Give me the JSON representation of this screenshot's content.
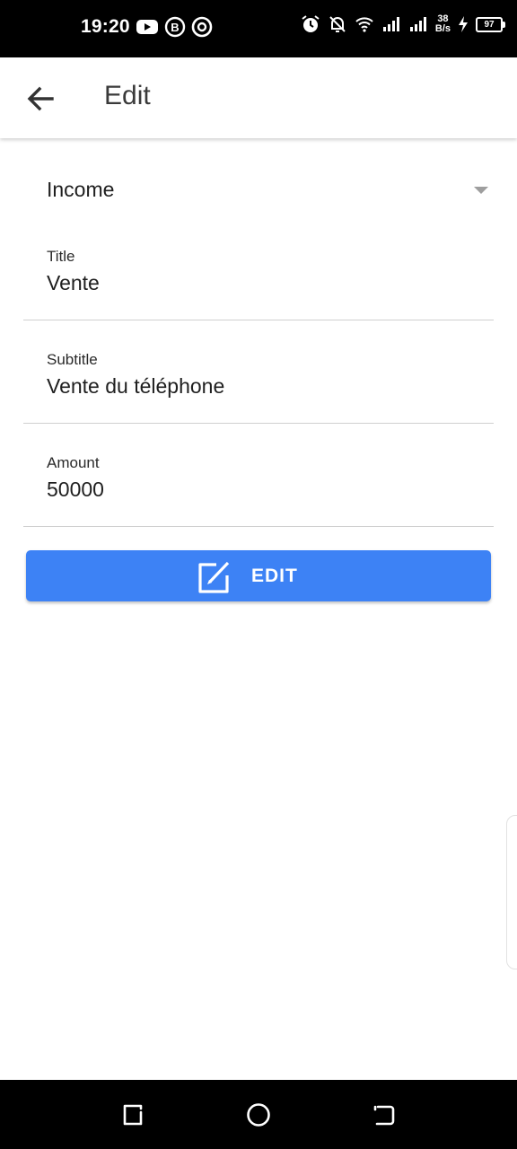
{
  "status_bar": {
    "time": "19:20",
    "net_speed_value": "38",
    "net_speed_unit": "B/s",
    "battery": "97",
    "icons": [
      "youtube-icon",
      "b-circle-icon",
      "at-circle-icon",
      "alarm-icon",
      "notifications-off-icon",
      "wifi-icon",
      "signal-icon",
      "signal-icon",
      "charging-icon"
    ]
  },
  "app_bar": {
    "title": "Edit",
    "back_icon": "arrow-back-icon"
  },
  "form": {
    "type_value": "Income",
    "fields": [
      {
        "label": "Title",
        "value": "Vente"
      },
      {
        "label": "Subtitle",
        "value": "Vente du téléphone"
      },
      {
        "label": "Amount",
        "value": "50000"
      }
    ],
    "submit_label": "EDIT",
    "submit_icon": "edit-square-icon"
  },
  "colors": {
    "primary": "#3d82f5",
    "text": "#1f1f1f",
    "divider": "#cfcfcf"
  },
  "nav_bar": {
    "icons": [
      "recent-apps-icon",
      "home-icon",
      "back-icon"
    ]
  }
}
